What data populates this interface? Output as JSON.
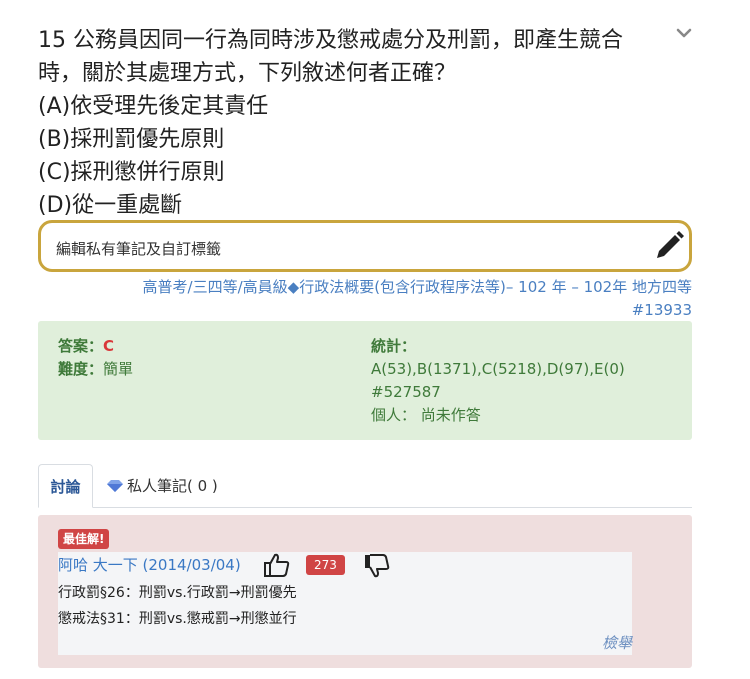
{
  "question": {
    "line1": "15 公務員因同一行為同時涉及懲戒處分及刑罰，即產生競合",
    "line2": "時，關於其處理方式，下列敘述何者正確？",
    "options": [
      "(A)依受理先後定其責任",
      "(B)採刑罰優先原則",
      "(C)採刑懲併行原則",
      "(D)從一重處斷"
    ]
  },
  "note": {
    "label": "編輯私有筆記及自訂標籤"
  },
  "source": {
    "line1": "高普考/三四等/高員級◆行政法概要(包含行政程序法等)– 102 年 – 102年 地方四等",
    "line2": "#13933"
  },
  "stats": {
    "answer_label": "答案：",
    "answer_value": "C",
    "difficulty_label": "難度：",
    "difficulty_value": "簡單",
    "stats_label": "統計：",
    "stats_value": "A(53),B(1371),C(5218),D(97),E(0)",
    "id": "#527587",
    "personal": "個人： 尚未作答"
  },
  "tabs": {
    "discussion": "討論",
    "private_notes": "私人筆記( 0 )"
  },
  "discussion": {
    "badge": "最佳解!",
    "author": "阿哈 大一下 (2014/03/04)",
    "like_count": "273",
    "line1": "行政罰§26：刑罰vs.行政罰→刑罰優先",
    "line2": "懲戒法§31：刑罰vs.懲戒罰→刑懲並行",
    "report": "檢舉"
  },
  "colors": {
    "accent_gold": "#c9a53d",
    "link_blue": "#4a7fc1",
    "answer_red": "#d9383a",
    "stat_green": "#3f7a3a",
    "stats_bg": "#e0efdb",
    "discussion_bg": "#efdede"
  }
}
